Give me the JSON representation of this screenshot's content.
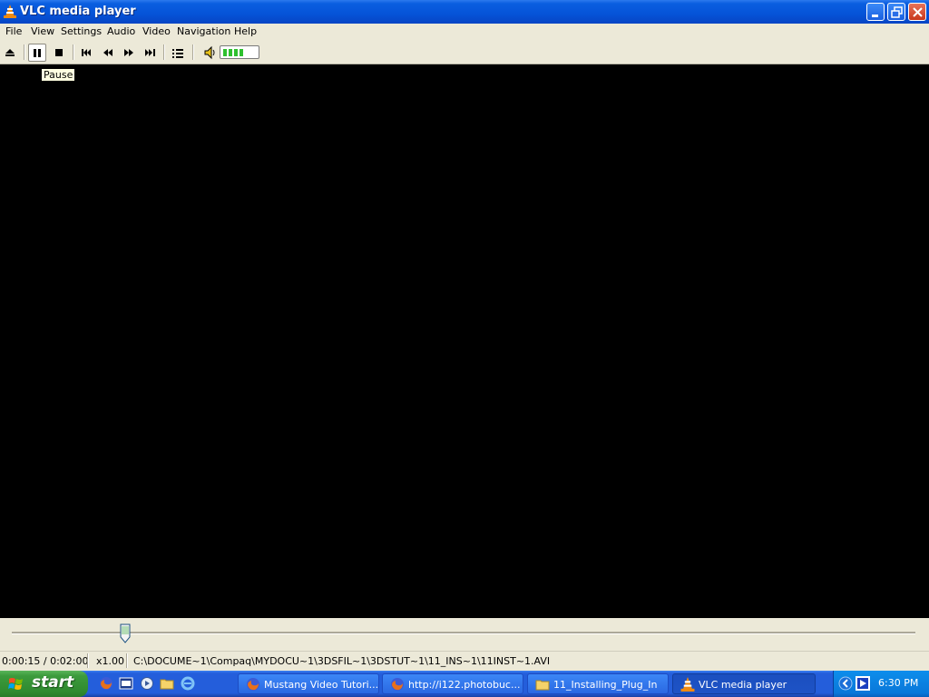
{
  "window": {
    "title": "VLC media player"
  },
  "menu": [
    "File",
    "View",
    "Settings",
    "Audio",
    "Video",
    "Navigation",
    "Help"
  ],
  "toolbar": {
    "buttons": [
      {
        "name": "eject-icon"
      },
      {
        "name": "pause-icon"
      },
      {
        "name": "stop-icon"
      },
      {
        "name": "skip-back-icon"
      },
      {
        "name": "rewind-icon"
      },
      {
        "name": "fast-forward-icon"
      },
      {
        "name": "skip-forward-icon"
      },
      {
        "name": "playlist-icon"
      },
      {
        "name": "speaker-icon"
      }
    ],
    "volume_level": 0.6
  },
  "tooltip": "Pause",
  "seek": {
    "position": 0.125
  },
  "status": {
    "time": "0:00:15 / 0:02:00",
    "speed": "x1.00",
    "path": "C:\\DOCUME~1\\Compaq\\MYDOCU~1\\3DSFIL~1\\3DSTUT~1\\11_INS~1\\11INST~1.AVI"
  },
  "taskbar": {
    "start_label": "start",
    "tasks": [
      {
        "label": "Mustang Video Tutori...",
        "icon": "firefox-icon",
        "active": false
      },
      {
        "label": "http://i122.photobuc...",
        "icon": "firefox-icon",
        "active": false
      },
      {
        "label": "11_Installing_Plug_In",
        "icon": "folder-icon",
        "active": false
      },
      {
        "label": "VLC media player",
        "icon": "vlc-cone-icon",
        "active": true
      }
    ],
    "clock": "6:30 PM"
  },
  "colors": {
    "title_bar": "#0553d8",
    "chrome": "#ece9d8",
    "taskbar": "#245edb",
    "start": "#3c9b3c",
    "volume": "#2ec02e"
  }
}
